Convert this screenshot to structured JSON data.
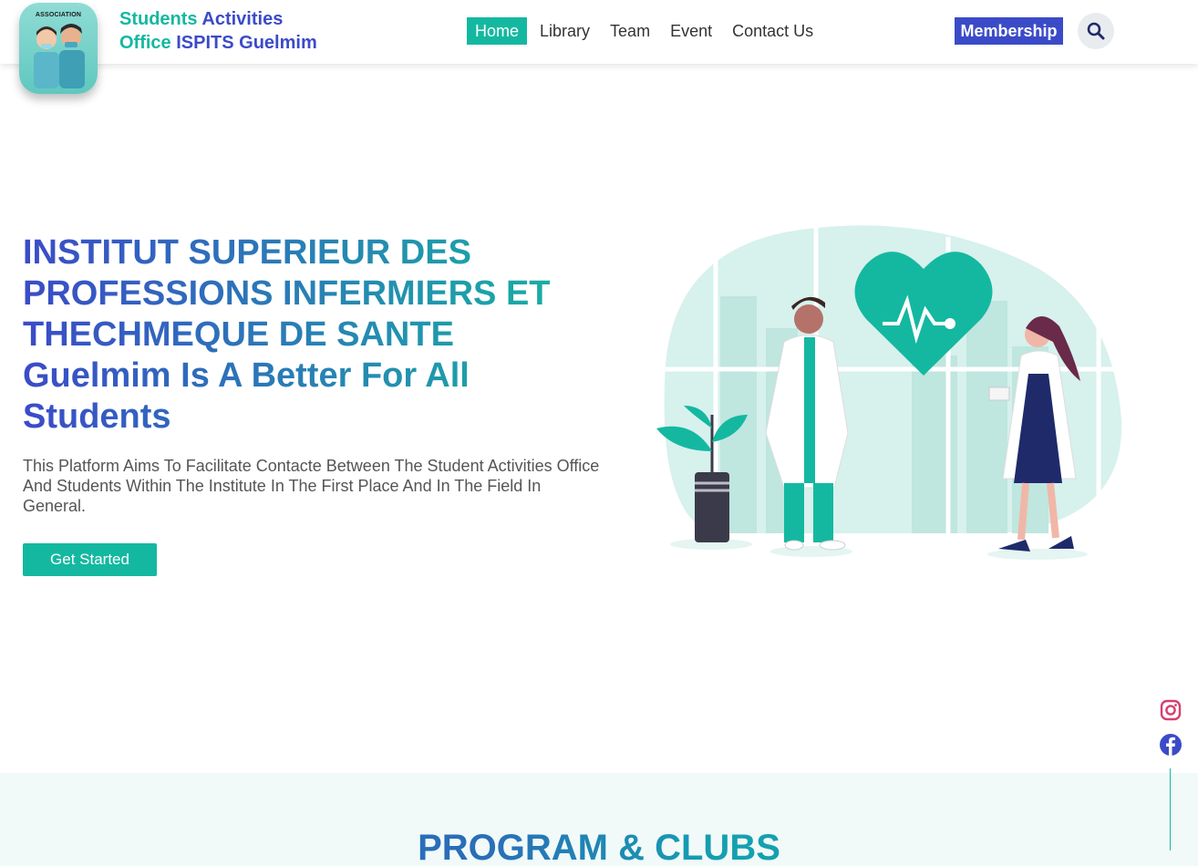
{
  "header": {
    "logo_text": "ASSOCIATION",
    "brand": {
      "line1_a": "Students",
      "line1_b": "Activities",
      "line2_a": "Office",
      "line2_b": "ISPITS Guelmim"
    },
    "nav": [
      {
        "label": "Home",
        "active": true
      },
      {
        "label": "Library",
        "active": false
      },
      {
        "label": "Team",
        "active": false
      },
      {
        "label": "Event",
        "active": false
      },
      {
        "label": "Contact Us",
        "active": false
      }
    ],
    "membership_label": "Membership",
    "search_icon": "search-icon"
  },
  "hero": {
    "title": "INSTITUT SUPERIEUR DES PROFESSIONS INFERMIERS ET THECHMEQUE DE SANTE Guelmim Is A Better For All Students",
    "description": "This Platform Aims To Facilitate Contacte Between The Student Activities Office And Students Within The Institute In The First Place And In The Field In General.",
    "cta_label": "Get Started"
  },
  "social": {
    "icons": [
      "instagram-icon",
      "facebook-icon"
    ]
  },
  "section": {
    "title": "PROGRAM & CLUBS"
  },
  "colors": {
    "teal": "#14b8a0",
    "blue": "#3b4bc8",
    "section_bg": "#f1faf9"
  }
}
